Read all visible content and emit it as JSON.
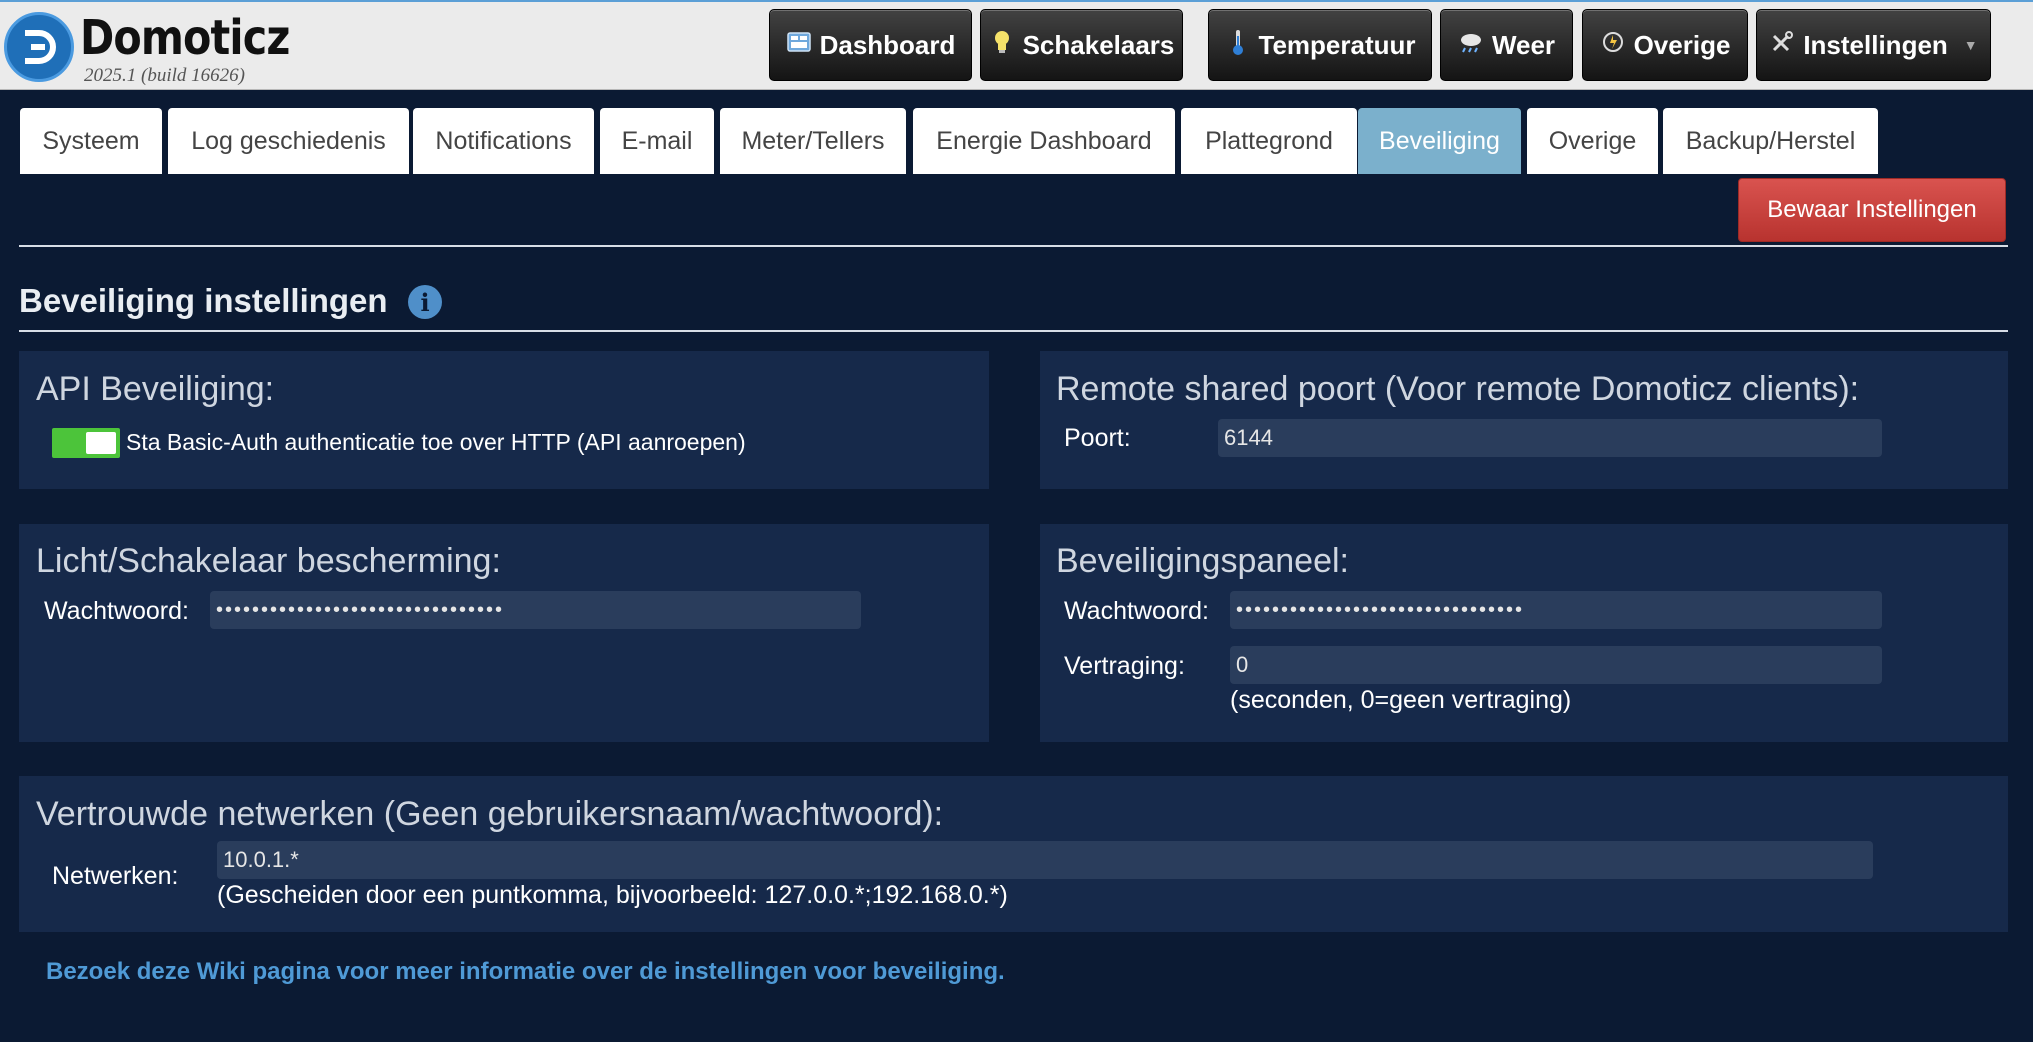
{
  "app": {
    "name": "Domoticz",
    "version": "2025.1 (build 16626)"
  },
  "nav": [
    {
      "label": "Dashboard",
      "icon": "dashboard-icon"
    },
    {
      "label": "Schakelaars",
      "icon": "lightbulb-icon"
    },
    {
      "label": "Temperatuur",
      "icon": "thermometer-icon"
    },
    {
      "label": "Weer",
      "icon": "weather-icon"
    },
    {
      "label": "Overige",
      "icon": "utility-icon"
    },
    {
      "label": "Instellingen",
      "icon": "tools-icon",
      "has_dropdown": true
    }
  ],
  "tabs": [
    {
      "label": "Systeem",
      "active": false
    },
    {
      "label": "Log geschiedenis",
      "active": false
    },
    {
      "label": "Notifications",
      "active": false
    },
    {
      "label": "E-mail",
      "active": false
    },
    {
      "label": "Meter/Tellers",
      "active": false
    },
    {
      "label": "Energie Dashboard",
      "active": false
    },
    {
      "label": "Plattegrond",
      "active": false
    },
    {
      "label": "Beveiliging",
      "active": true
    },
    {
      "label": "Overige",
      "active": false
    },
    {
      "label": "Backup/Herstel",
      "active": false
    }
  ],
  "save_button": "Bewaar Instellingen",
  "section_title": "Beveiliging instellingen",
  "api_panel": {
    "title": "API Beveiliging:",
    "toggle_label": "Sta Basic-Auth authenticatie toe over HTTP (API aanroepen)",
    "toggle_on": true
  },
  "remote_panel": {
    "title": "Remote shared poort (Voor remote Domoticz clients):",
    "port_label": "Poort:",
    "port_value": "6144"
  },
  "light_panel": {
    "title": "Licht/Schakelaar bescherming:",
    "password_label": "Wachtwoord:",
    "password_value": "••••••••••••••••••••••••••••••••"
  },
  "security_panel": {
    "title": "Beveiligingspaneel:",
    "password_label": "Wachtwoord:",
    "password_value": "••••••••••••••••••••••••••••••••",
    "delay_label": "Vertraging:",
    "delay_value": "0",
    "delay_hint": "(seconden, 0=geen vertraging)"
  },
  "networks_panel": {
    "title": "Vertrouwde netwerken (Geen gebruikersnaam/wachtwoord):",
    "networks_label": "Netwerken:",
    "networks_value": "10.0.1.*",
    "networks_hint": "(Gescheiden door een puntkomma, bijvoorbeeld: 127.0.0.*;192.168.0.*)"
  },
  "wiki_link": "Bezoek deze Wiki pagina voor meer informatie over de instellingen voor beveiliging.",
  "colors": {
    "background": "#0b1a33",
    "panel": "#16294a",
    "active_tab": "#7bb0cc",
    "save_button": "#d9534f",
    "toggle_on": "#4cc43a",
    "link": "#4f9ad6"
  }
}
